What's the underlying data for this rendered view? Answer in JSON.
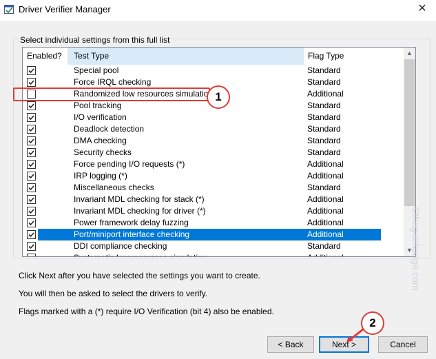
{
  "window": {
    "title": "Driver Verifier Manager",
    "close_glyph": "✕"
  },
  "group_label": "Select individual settings from this full list",
  "columns": {
    "enabled": "Enabled?",
    "test_type": "Test Type",
    "flag_type": "Flag Type"
  },
  "rows": [
    {
      "checked": true,
      "name": "Special pool",
      "flag": "Standard"
    },
    {
      "checked": true,
      "name": "Force IRQL checking",
      "flag": "Standard"
    },
    {
      "checked": false,
      "name": "Randomized low resources simulation",
      "flag": "Additional"
    },
    {
      "checked": true,
      "name": "Pool tracking",
      "flag": "Standard"
    },
    {
      "checked": true,
      "name": "I/O verification",
      "flag": "Standard"
    },
    {
      "checked": true,
      "name": "Deadlock detection",
      "flag": "Standard"
    },
    {
      "checked": true,
      "name": "DMA checking",
      "flag": "Standard"
    },
    {
      "checked": true,
      "name": "Security checks",
      "flag": "Standard"
    },
    {
      "checked": true,
      "name": "Force pending I/O requests (*)",
      "flag": "Additional"
    },
    {
      "checked": true,
      "name": "IRP logging (*)",
      "flag": "Additional"
    },
    {
      "checked": true,
      "name": "Miscellaneous checks",
      "flag": "Standard"
    },
    {
      "checked": true,
      "name": "Invariant MDL checking for stack (*)",
      "flag": "Additional"
    },
    {
      "checked": true,
      "name": "Invariant MDL checking for driver (*)",
      "flag": "Additional"
    },
    {
      "checked": true,
      "name": "Power framework delay fuzzing",
      "flag": "Additional"
    },
    {
      "checked": true,
      "name": "Port/miniport interface checking",
      "flag": "Additional",
      "selected": true
    },
    {
      "checked": true,
      "name": "DDI compliance checking",
      "flag": "Standard"
    },
    {
      "checked": true,
      "name": "Systematic low resources simulation",
      "flag": "Additional"
    }
  ],
  "info": {
    "line1": "Click Next after you have selected the settings you want to create.",
    "line2": "You will then be asked to select the drivers to verify.",
    "line3": "Flags marked with a (*) require I/O Verification (bit 4) also be enabled."
  },
  "buttons": {
    "back": "< Back",
    "next": "Next >",
    "cancel": "Cancel"
  },
  "annotations": {
    "step1": "1",
    "step2": "2",
    "highlight_color": "#e23a3a"
  },
  "watermark": "©thegeekpage.com",
  "colors": {
    "selection": "#0078d7",
    "header_highlight": "#d9ebf9"
  }
}
